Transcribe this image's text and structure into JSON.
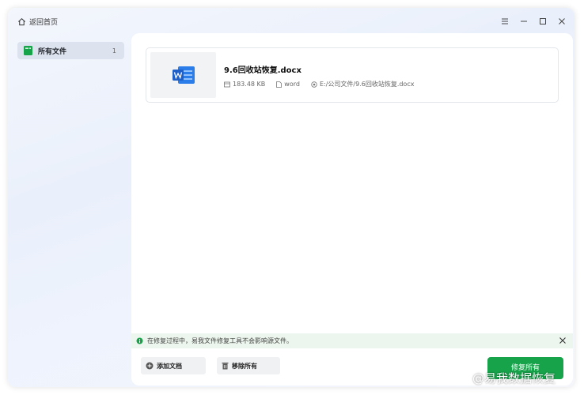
{
  "titlebar": {
    "back_label": "返回首页",
    "controls": [
      "menu-icon",
      "minimize-icon",
      "maximize-icon",
      "close-icon"
    ]
  },
  "sidebar": {
    "items": [
      {
        "label": "所有文件",
        "count": "1",
        "icon": "folder-icon"
      }
    ]
  },
  "files": [
    {
      "name": "9.6回收站恢复.docx",
      "size": "183.48 KB",
      "type": "word",
      "path": "E:/公司文件/9.6回收站恢复.docx",
      "icon": "word-file-icon"
    }
  ],
  "notice": {
    "text": "在修复过程中，易我文件修复工具不会影响源文件。"
  },
  "actions": {
    "add_label": "添加文档",
    "remove_label": "移除所有",
    "repair_label": "修复所有"
  },
  "watermark": {
    "text": "@易我数据恢复"
  },
  "colors": {
    "primary": "#16a34a",
    "sidebar_active": "#dde3ee",
    "notice_bg": "#edf6ee"
  }
}
